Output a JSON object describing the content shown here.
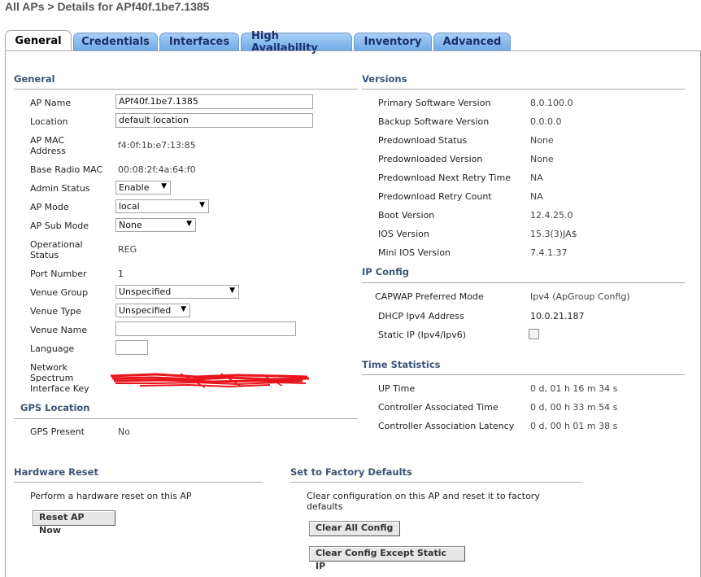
{
  "page_title": "All APs > Details for APf40f.1be7.1385",
  "tabs": [
    {
      "label": "General",
      "active": true
    },
    {
      "label": "Credentials"
    },
    {
      "label": "Interfaces"
    },
    {
      "label": "High Availability"
    },
    {
      "label": "Inventory"
    },
    {
      "label": "Advanced"
    }
  ],
  "general": {
    "title": "General",
    "ap_name": {
      "label": "AP Name",
      "value": "APf40f.1be7.1385"
    },
    "location": {
      "label": "Location",
      "value": "default location"
    },
    "ap_mac": {
      "label_1": "AP MAC",
      "label_2": "Address",
      "value": "f4:0f:1b:e7:13:85"
    },
    "base_radio_mac": {
      "label": "Base Radio MAC",
      "value": "00:08:2f:4a:64:f0"
    },
    "admin_status": {
      "label": "Admin Status",
      "value": "Enable"
    },
    "ap_mode": {
      "label": "AP Mode",
      "value": "local"
    },
    "ap_sub_mode": {
      "label": "AP Sub Mode",
      "value": "None"
    },
    "operational_status": {
      "label_1": "Operational",
      "label_2": "Status",
      "value": "REG"
    },
    "port_number": {
      "label": "Port Number",
      "value": "1"
    },
    "venue_group": {
      "label": "Venue Group",
      "value": "Unspecified"
    },
    "venue_type": {
      "label": "Venue Type",
      "value": "Unspecified"
    },
    "venue_name": {
      "label": "Venue Name",
      "value": ""
    },
    "language": {
      "label": "Language",
      "value": ""
    },
    "nsi_key": {
      "label_1": "Network",
      "label_2": "Spectrum",
      "label_3": "Interface Key"
    }
  },
  "gps": {
    "title": "GPS Location",
    "gps_present": {
      "label": "GPS Present",
      "value": "No"
    }
  },
  "versions": {
    "title": "Versions",
    "rows": [
      {
        "label": "Primary Software Version",
        "value": "8.0.100.0"
      },
      {
        "label": "Backup Software Version",
        "value": "0.0.0.0"
      },
      {
        "label": "Predownload Status",
        "value": "None"
      },
      {
        "label": "Predownloaded Version",
        "value": "None"
      },
      {
        "label": "Predownload Next Retry Time",
        "value": "NA"
      },
      {
        "label": "Predownload Retry Count",
        "value": "NA"
      },
      {
        "label": "Boot Version",
        "value": "12.4.25.0"
      },
      {
        "label": "IOS Version",
        "value": "15.3(3)JA$"
      },
      {
        "label": "Mini IOS Version",
        "value": "7.4.1.37"
      }
    ]
  },
  "ip_config": {
    "title": "IP Config",
    "capwap": {
      "label": "CAPWAP Preferred Mode",
      "value": "Ipv4 (ApGroup Config)"
    },
    "dhcp": {
      "label": "DHCP Ipv4 Address",
      "value": "10.0.21.187"
    },
    "static_ip": {
      "label": "Static IP (Ipv4/Ipv6)",
      "checked": false
    }
  },
  "time_statistics": {
    "title": "Time Statistics",
    "rows": [
      {
        "label": "UP Time",
        "value": "0 d, 01 h 16 m 34 s"
      },
      {
        "label": "Controller Associated Time",
        "value": "0 d, 00 h 33 m 54 s"
      },
      {
        "label": "Controller Association Latency",
        "value": "0 d, 00 h 01 m 38 s"
      }
    ]
  },
  "hardware_reset": {
    "title": "Hardware Reset",
    "description": "Perform a hardware reset on this AP",
    "button": "Reset AP Now"
  },
  "factory_defaults": {
    "title": "Set to Factory Defaults",
    "description_1": "Clear configuration on this AP and reset it to factory",
    "description_2": "defaults",
    "clear_all_button": "Clear All Config",
    "clear_except_button": "Clear Config Except Static IP"
  },
  "colors": {
    "tab_gradient_top": "#a9d0f7",
    "tab_gradient_bottom": "#6fa9e6",
    "section_title": "#3c5478",
    "redaction": "#e8141c"
  }
}
